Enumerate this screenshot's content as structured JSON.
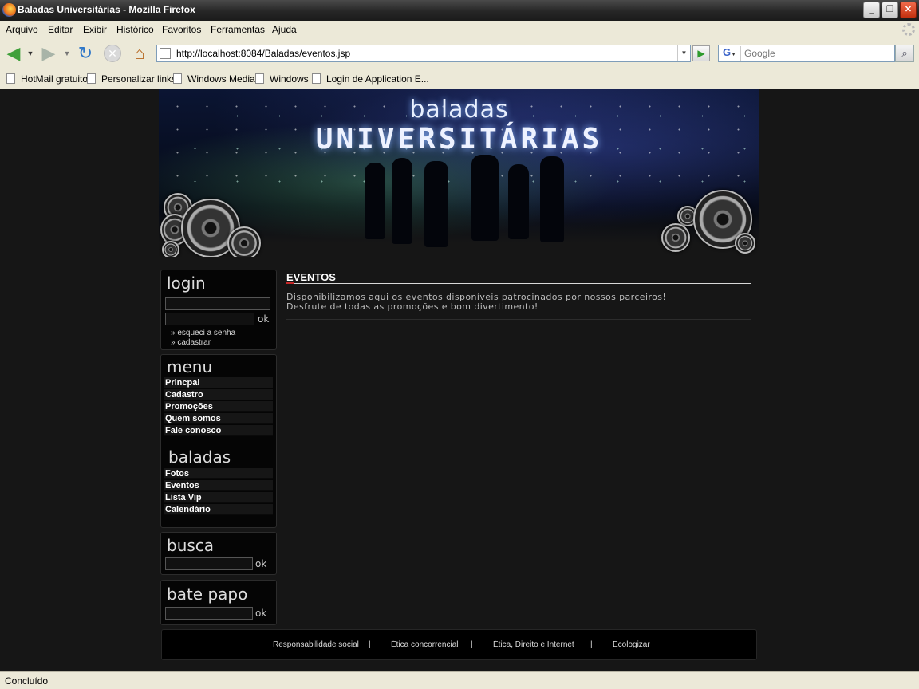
{
  "window": {
    "title": "Baladas Universitárias - Mozilla Firefox",
    "controls": {
      "minimize": "_",
      "maximize": "❐",
      "close": "✕"
    }
  },
  "menubar": {
    "items": [
      "Arquivo",
      "Editar",
      "Exibir",
      "Histórico",
      "Favoritos",
      "Ferramentas",
      "Ajuda"
    ]
  },
  "navbar": {
    "back_icon": "back-arrow-icon",
    "forward_icon": "forward-arrow-icon",
    "reload_icon": "reload-icon",
    "stop_icon": "stop-icon",
    "home_icon": "home-icon",
    "url": "http://localhost:8084/Baladas/eventos.jsp",
    "search_engine": "G",
    "search_placeholder": "Google"
  },
  "bookmarks": [
    "HotMail gratuito",
    "Personalizar links",
    "Windows Media",
    "Windows",
    "Login de Application E..."
  ],
  "banner": {
    "logo_top": "baladas",
    "logo_main": "UNIVERSITÁRIAS"
  },
  "sidebar": {
    "login": {
      "title": "login",
      "ok": "ok",
      "forgot": "» esqueci a senha",
      "register": "» cadastrar"
    },
    "menu": {
      "title": "menu",
      "items": [
        "Princpal",
        "Cadastro",
        "Promoções",
        "Quem somos",
        "Fale conosco"
      ]
    },
    "baladas": {
      "title": "baladas",
      "items": [
        "Fotos",
        "Eventos",
        "Lista Vip",
        "Calendário"
      ]
    },
    "busca": {
      "title": "busca",
      "ok": "ok"
    },
    "batepapo": {
      "title": "bate papo",
      "ok": "ok"
    }
  },
  "content": {
    "title": "EVENTOS",
    "line1": "Disponibilizamos aqui os eventos disponíveis patrocinados por nossos parceiros!",
    "line2": "Desfrute de todas as promoções e bom divertimento!"
  },
  "footer": {
    "links": [
      "Responsabilidade social",
      "Ética concorrencial",
      "Ética, Direito e Internet",
      "Ecologizar"
    ],
    "separator": "|"
  },
  "status": "Concluído",
  "colors": {
    "page_bg": "#161616",
    "chrome_bg": "#ece9d8",
    "accent_red": "#c62828"
  }
}
